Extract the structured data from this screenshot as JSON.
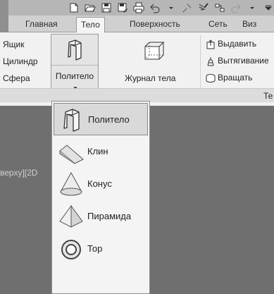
{
  "quick_access": {
    "icons": [
      "new-icon",
      "open-icon",
      "save-icon",
      "save-as-icon",
      "print-icon",
      "undo-icon",
      "dropdown-arrow-icon",
      "match-properties-icon",
      "brush-icon",
      "workspace-icon",
      "redo-icon",
      "dropdown-arrow-icon",
      "customize-icon"
    ]
  },
  "tabs": [
    {
      "label": "Главная"
    },
    {
      "label": "Тело"
    },
    {
      "label": "Поверхность"
    },
    {
      "label": "Сеть"
    },
    {
      "label": "Виз"
    }
  ],
  "ribbon": {
    "primitives": [
      {
        "label": "Ящик"
      },
      {
        "label": "Цилиндр"
      },
      {
        "label": "Сфера"
      }
    ],
    "polysolid_button": {
      "label": "Политело"
    },
    "history_button": {
      "label": "Журнал тела"
    },
    "solid_ops": [
      {
        "label": "Выдавить"
      },
      {
        "label": "Вытягивание"
      },
      {
        "label": "Вращать"
      }
    ],
    "panel_footer_label": "Те"
  },
  "viewport": {
    "label": "верху][2D"
  },
  "dropdown": {
    "items": [
      {
        "label": "Политело",
        "icon": "polysolid-icon",
        "selected": true
      },
      {
        "label": "Клин",
        "icon": "wedge-icon"
      },
      {
        "label": "Конус",
        "icon": "cone-icon"
      },
      {
        "label": "Пирамида",
        "icon": "pyramid-icon"
      },
      {
        "label": "Тор",
        "icon": "torus-icon"
      }
    ]
  }
}
